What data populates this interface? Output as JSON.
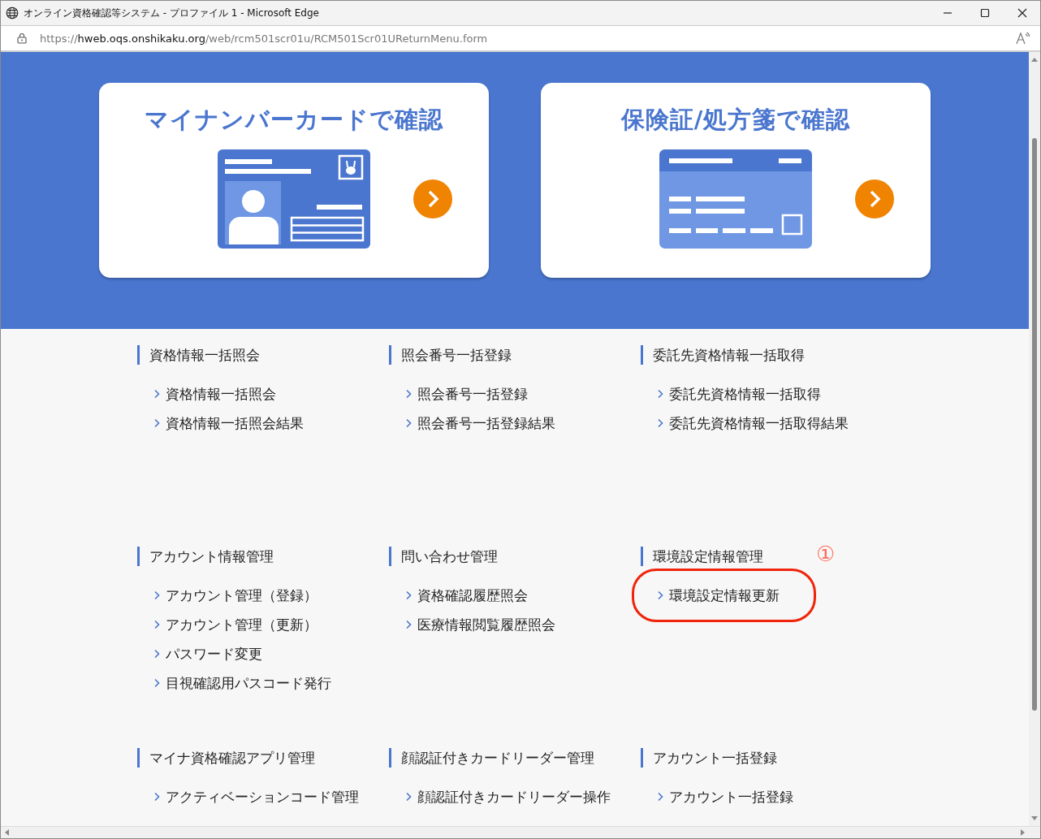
{
  "window": {
    "title": "オンライン資格確認等システム - プロファイル 1 - Microsoft Edge"
  },
  "address_bar": {
    "scheme": "https://",
    "host": "hweb.oqs.onshikaku.org",
    "path": "/web/rcm501scr01u/RCM501Scr01UReturnMenu.form"
  },
  "hero_cards": [
    {
      "title": "マイナンバーカードで確認",
      "kind": "my-number"
    },
    {
      "title": "保険証/処方箋で確認",
      "kind": "insurance"
    }
  ],
  "menu_sections": [
    {
      "title": "資格情報一括照会",
      "items": [
        {
          "label": "資格情報一括照会",
          "highlighted": false
        },
        {
          "label": "資格情報一括照会結果",
          "highlighted": false
        }
      ]
    },
    {
      "title": "照会番号一括登録",
      "items": [
        {
          "label": "照会番号一括登録",
          "highlighted": false
        },
        {
          "label": "照会番号一括登録結果",
          "highlighted": false
        }
      ]
    },
    {
      "title": "委託先資格情報一括取得",
      "items": [
        {
          "label": "委託先資格情報一括取得",
          "highlighted": false
        },
        {
          "label": "委託先資格情報一括取得結果",
          "highlighted": false
        }
      ]
    },
    {
      "title": "アカウント情報管理",
      "items": [
        {
          "label": "アカウント管理（登録）",
          "highlighted": false
        },
        {
          "label": "アカウント管理（更新）",
          "highlighted": false
        },
        {
          "label": "パスワード変更",
          "highlighted": false
        },
        {
          "label": "目視確認用パスコード発行",
          "highlighted": false
        }
      ]
    },
    {
      "title": "問い合わせ管理",
      "items": [
        {
          "label": "資格確認履歴照会",
          "highlighted": false
        },
        {
          "label": "医療情報閲覧履歴照会",
          "highlighted": false
        }
      ]
    },
    {
      "title": "環境設定情報管理",
      "annotation": "①",
      "items": [
        {
          "label": "環境設定情報更新",
          "highlighted": true
        }
      ]
    },
    {
      "title": "マイナ資格確認アプリ管理",
      "items": [
        {
          "label": "アクティベーションコード管理",
          "highlighted": false
        }
      ]
    },
    {
      "title": "顔認証付きカードリーダー管理",
      "items": [
        {
          "label": "顔認証付きカードリーダー操作",
          "highlighted": false
        }
      ]
    },
    {
      "title": "アカウント一括登録",
      "items": [
        {
          "label": "アカウント一括登録",
          "highlighted": false
        }
      ]
    }
  ]
}
